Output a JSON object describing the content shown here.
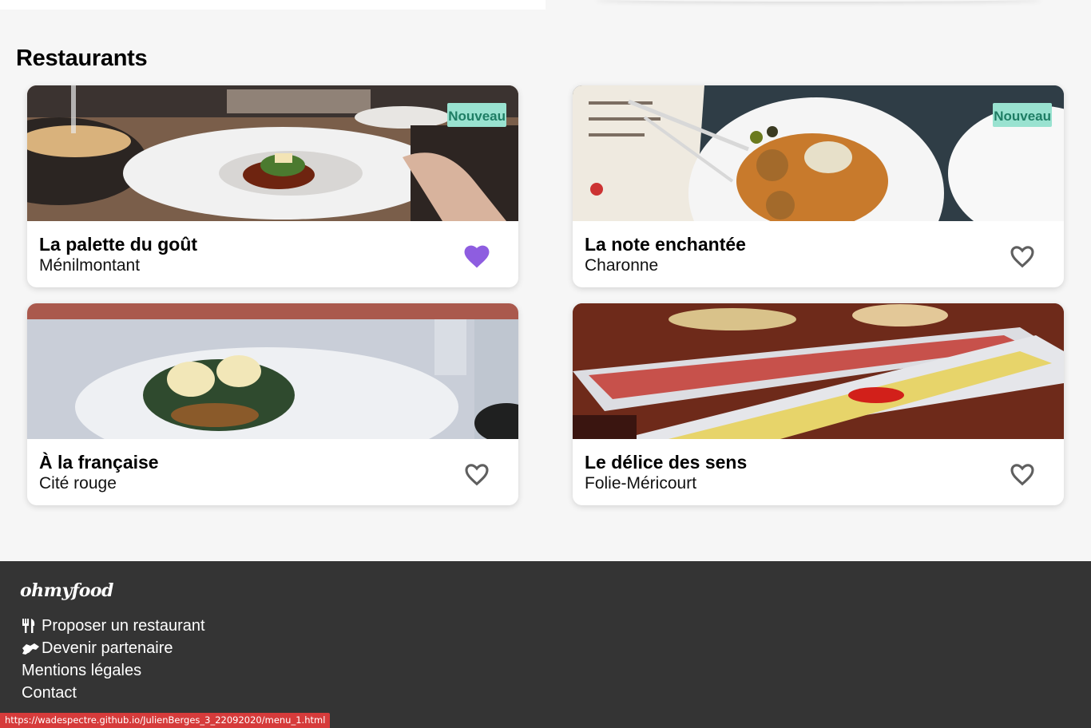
{
  "section": {
    "title": "Restaurants"
  },
  "restaurants": [
    {
      "name": "La palette du goût",
      "area": "Ménilmontant",
      "badge": "Nouveau",
      "favorite": true
    },
    {
      "name": "La note enchantée",
      "area": "Charonne",
      "badge": "Nouveau",
      "favorite": false
    },
    {
      "name": "À la française",
      "area": "Cité rouge",
      "badge": "",
      "favorite": false
    },
    {
      "name": "Le délice des sens",
      "area": "Folie-Méricourt",
      "badge": "",
      "favorite": false
    }
  ],
  "colors": {
    "accent_heart": "#8e5de0",
    "badge_bg": "#99e2d0",
    "badge_text": "#1e7d64",
    "footer_bg": "#343434",
    "status_bg": "#d63b3b"
  },
  "footer": {
    "logo": "ohmyfood",
    "links": [
      {
        "label": "Proposer un restaurant",
        "icon": "utensils-icon"
      },
      {
        "label": "Devenir partenaire",
        "icon": "handshake-icon"
      },
      {
        "label": "Mentions légales",
        "icon": ""
      },
      {
        "label": "Contact",
        "icon": ""
      }
    ]
  },
  "status_url": "https://wadespectre.github.io/JulienBerges_3_22092020/menu_1.html"
}
